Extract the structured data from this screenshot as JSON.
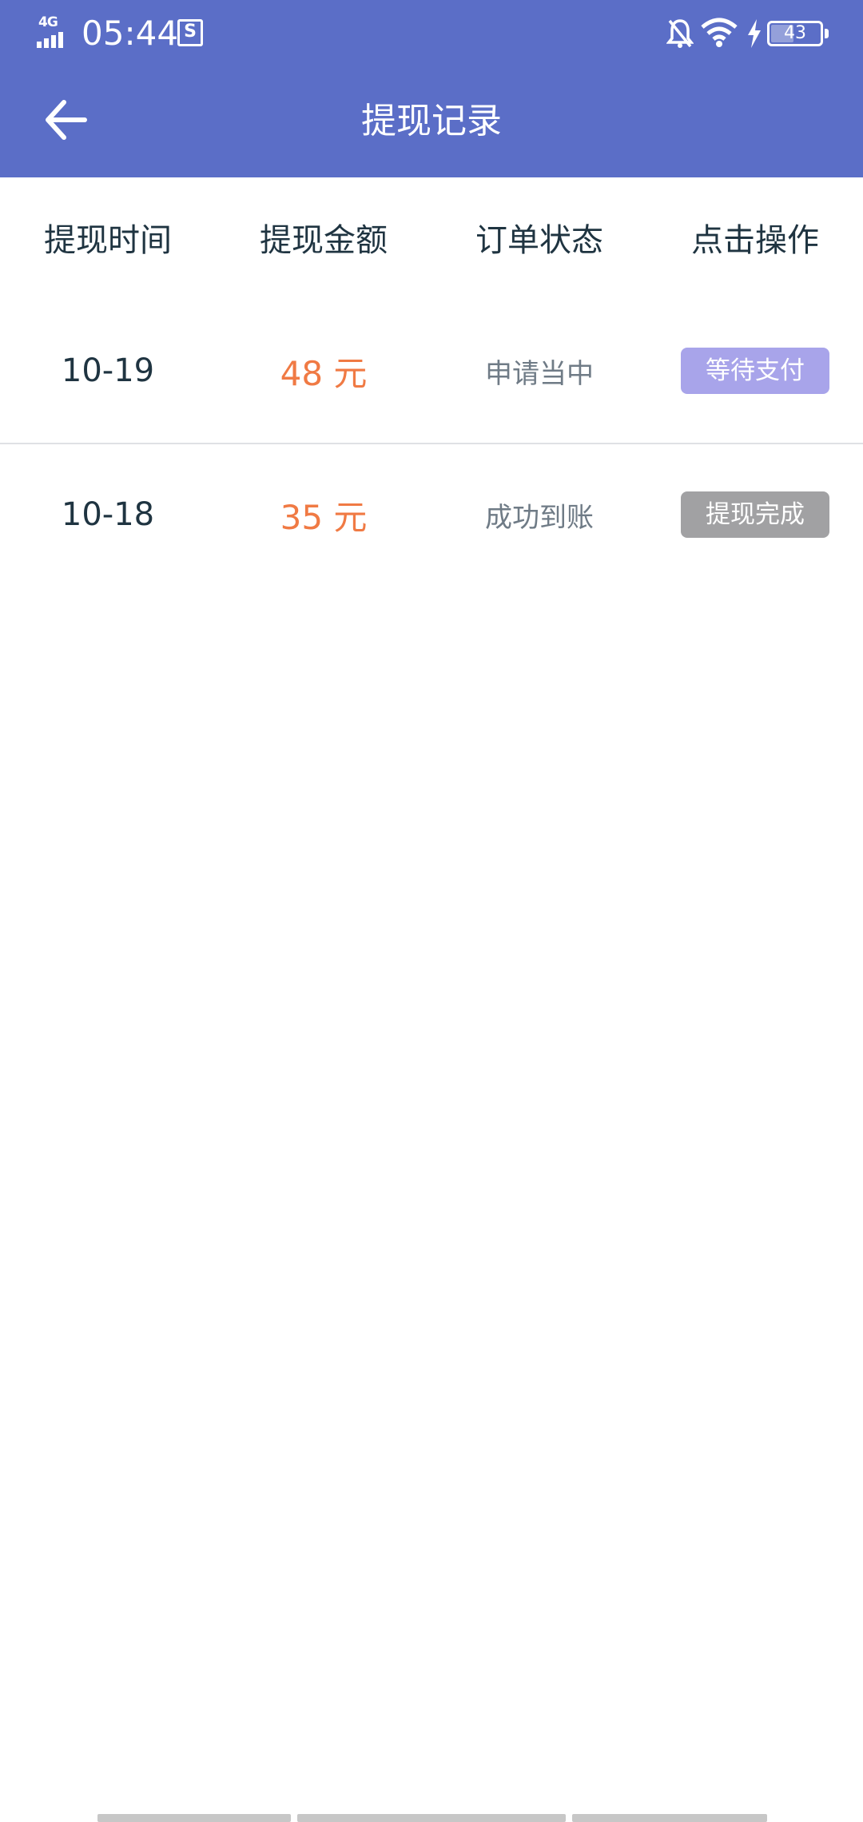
{
  "status_bar": {
    "network": "4G",
    "time": "05:44",
    "battery": "43",
    "battery_level": 0.43
  },
  "header": {
    "title": "提现记录"
  },
  "table": {
    "columns": [
      "提现时间",
      "提现金额",
      "订单状态",
      "点击操作"
    ],
    "rows": [
      {
        "date": "10-19",
        "amount": "48 元",
        "status": "申请当中",
        "action": "等待支付",
        "action_color": "#a8a4ea"
      },
      {
        "date": "10-18",
        "amount": "35 元",
        "status": "成功到账",
        "action": "提现完成",
        "action_color": "#a1a1a3"
      }
    ]
  },
  "colors": {
    "header_bg": "#5b6ec7",
    "amount": "#f07a44",
    "status_text": "#6f7b86"
  }
}
